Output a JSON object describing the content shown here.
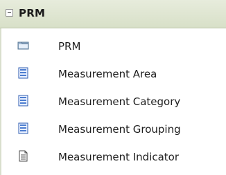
{
  "section": {
    "title": "PRM"
  },
  "items": [
    {
      "label": "PRM",
      "icon": "folder-icon"
    },
    {
      "label": "Measurement Area",
      "icon": "list-icon"
    },
    {
      "label": "Measurement Category",
      "icon": "list-icon"
    },
    {
      "label": "Measurement Grouping",
      "icon": "list-icon"
    },
    {
      "label": "Measurement Indicator",
      "icon": "document-icon"
    }
  ]
}
